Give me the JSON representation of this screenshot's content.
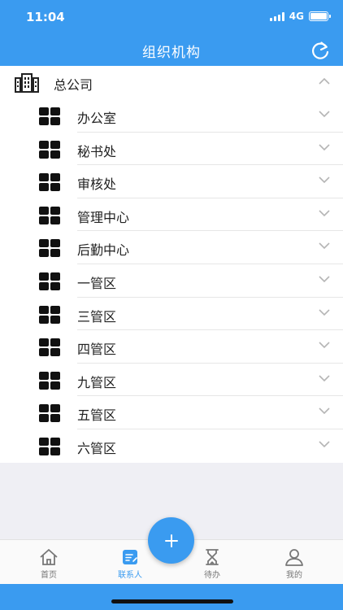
{
  "status_bar": {
    "time": "11:04",
    "network": "4G"
  },
  "header": {
    "title": "组织机构",
    "refresh_icon": "refresh-icon",
    "color": "#3a9bf0"
  },
  "tree": {
    "root": {
      "label": "总公司",
      "icon": "building-icon",
      "expanded": true
    },
    "children": [
      {
        "label": "办公室"
      },
      {
        "label": "秘书处"
      },
      {
        "label": "审核处"
      },
      {
        "label": "管理中心"
      },
      {
        "label": "后勤中心"
      },
      {
        "label": "一管区"
      },
      {
        "label": "三管区"
      },
      {
        "label": "四管区"
      },
      {
        "label": "九管区"
      },
      {
        "label": "五管区"
      },
      {
        "label": "六管区"
      }
    ]
  },
  "fab": {
    "icon": "plus-icon"
  },
  "tabbar": {
    "active": 1,
    "tabs": [
      {
        "label": "首页",
        "icon": "home-icon"
      },
      {
        "label": "联系人",
        "icon": "contacts-icon"
      },
      {
        "label": "待办",
        "icon": "hourglass-icon"
      },
      {
        "label": "我的",
        "icon": "user-icon"
      }
    ]
  }
}
